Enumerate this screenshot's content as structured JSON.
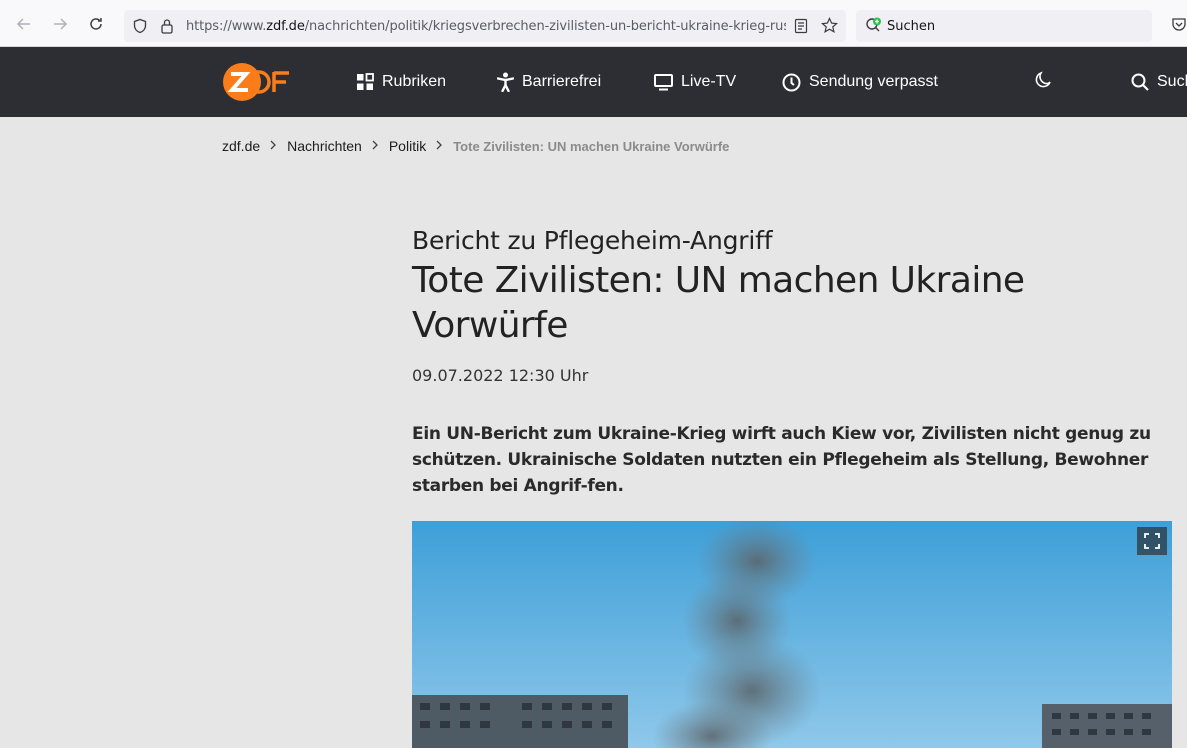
{
  "browser": {
    "url_prefix": "https://www.",
    "url_domain": "zdf.de",
    "url_path": "/nachrichten/politik/kriegsverbrechen-zivilisten-un-bericht-ukraine-krieg-russland",
    "search_placeholder": "Suchen"
  },
  "header": {
    "nav": [
      {
        "label": "Rubriken",
        "icon": "grid-icon"
      },
      {
        "label": "Barrierefrei",
        "icon": "accessibility-icon"
      },
      {
        "label": "Live-TV",
        "icon": "tv-icon"
      },
      {
        "label": "Sendung verpasst",
        "icon": "clock-icon"
      }
    ],
    "search_label": "Suche"
  },
  "breadcrumb": [
    "zdf.de",
    "Nachrichten",
    "Politik",
    "Tote Zivilisten: UN machen Ukraine Vorwürfe"
  ],
  "article": {
    "kicker": "Bericht zu Pflegeheim-Angriff",
    "headline": "Tote Zivilisten: UN machen Ukraine Vorwürfe",
    "date": "09.07.2022 12:30 Uhr",
    "lead": "Ein UN-Bericht zum Ukraine-Krieg wirft auch Kiew vor, Zivilisten nicht genug zu schützen. Ukrainische Soldaten nutzten ein Pflegeheim als Stellung, Bewohner starben bei Angrif-fen."
  },
  "colors": {
    "header_bg": "#2c2e33",
    "brand_orange": "#fa7d19",
    "page_bg": "#e6e6e6"
  }
}
